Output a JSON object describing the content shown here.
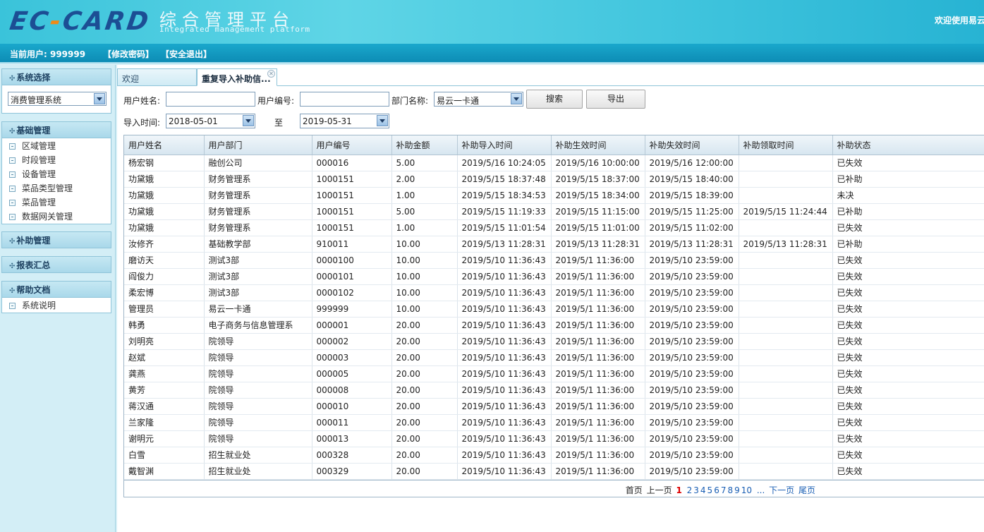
{
  "header": {
    "logo_left": "EC",
    "logo_dash": "-",
    "logo_right": "CARD",
    "brand_cn": "综合管理平台",
    "brand_en": "Integrated management platform",
    "welcome": "欢迎使用易云"
  },
  "userbar": {
    "current_user": "当前用户: 999999",
    "change_password": "【修改密码】",
    "logout": "【安全退出】"
  },
  "sidebar": {
    "system_select_title": "系统选择",
    "system_select_value": "消费管理系统",
    "basic_title": "基础管理",
    "basic_items": [
      "区域管理",
      "时段管理",
      "设备管理",
      "菜品类型管理",
      "菜品管理",
      "数据网关管理"
    ],
    "subsidy_title": "补助管理",
    "report_title": "报表汇总",
    "help_title": "帮助文档",
    "help_items": [
      "系统说明"
    ]
  },
  "tabs": {
    "welcome": "欢迎",
    "active": "重复导入补助信..."
  },
  "filters": {
    "user_name_label": "用户姓名:",
    "user_name_value": "",
    "user_no_label": "用户编号:",
    "user_no_value": "",
    "dept_label": "部门名称:",
    "dept_value": "易云一卡通",
    "search_button": "搜索",
    "export_button": "导出",
    "import_time_label": "导入时间:",
    "start_date": "2018-05-01",
    "to_label": "至",
    "end_date": "2019-05-31"
  },
  "table": {
    "columns": [
      "用户姓名",
      "用户部门",
      "用户编号",
      "补助金额",
      "补助导入时间",
      "补助生效时间",
      "补助失效时间",
      "补助领取时间",
      "补助状态"
    ],
    "rows": [
      [
        "杨宏钢",
        "融创公司",
        "000016",
        "5.00",
        "2019/5/16 10:24:05",
        "2019/5/16 10:00:00",
        "2019/5/16 12:00:00",
        "",
        "已失效"
      ],
      [
        "功黛娥",
        "财务管理系",
        "1000151",
        "2.00",
        "2019/5/15 18:37:48",
        "2019/5/15 18:37:00",
        "2019/5/15 18:40:00",
        "",
        "已补助"
      ],
      [
        "功黛娥",
        "财务管理系",
        "1000151",
        "1.00",
        "2019/5/15 18:34:53",
        "2019/5/15 18:34:00",
        "2019/5/15 18:39:00",
        "",
        "未决"
      ],
      [
        "功黛娥",
        "财务管理系",
        "1000151",
        "5.00",
        "2019/5/15 11:19:33",
        "2019/5/15 11:15:00",
        "2019/5/15 11:25:00",
        "2019/5/15 11:24:44",
        "已补助"
      ],
      [
        "功黛娥",
        "财务管理系",
        "1000151",
        "1.00",
        "2019/5/15 11:01:54",
        "2019/5/15 11:01:00",
        "2019/5/15 11:02:00",
        "",
        "已失效"
      ],
      [
        "汝修齐",
        "基础教学部",
        "910011",
        "10.00",
        "2019/5/13 11:28:31",
        "2019/5/13 11:28:31",
        "2019/5/13 11:28:31",
        "2019/5/13 11:28:31",
        "已补助"
      ],
      [
        "磨访天",
        "测试3部",
        "0000100",
        "10.00",
        "2019/5/10 11:36:43",
        "2019/5/1 11:36:00",
        "2019/5/10 23:59:00",
        "",
        "已失效"
      ],
      [
        "阎俊力",
        "测试3部",
        "0000101",
        "10.00",
        "2019/5/10 11:36:43",
        "2019/5/1 11:36:00",
        "2019/5/10 23:59:00",
        "",
        "已失效"
      ],
      [
        "柔宏博",
        "测试3部",
        "0000102",
        "10.00",
        "2019/5/10 11:36:43",
        "2019/5/1 11:36:00",
        "2019/5/10 23:59:00",
        "",
        "已失效"
      ],
      [
        "管理员",
        "易云一卡通",
        "999999",
        "10.00",
        "2019/5/10 11:36:43",
        "2019/5/1 11:36:00",
        "2019/5/10 23:59:00",
        "",
        "已失效"
      ],
      [
        "韩勇",
        "电子商务与信息管理系",
        "000001",
        "20.00",
        "2019/5/10 11:36:43",
        "2019/5/1 11:36:00",
        "2019/5/10 23:59:00",
        "",
        "已失效"
      ],
      [
        "刘明亮",
        "院领导",
        "000002",
        "20.00",
        "2019/5/10 11:36:43",
        "2019/5/1 11:36:00",
        "2019/5/10 23:59:00",
        "",
        "已失效"
      ],
      [
        "赵斌",
        "院领导",
        "000003",
        "20.00",
        "2019/5/10 11:36:43",
        "2019/5/1 11:36:00",
        "2019/5/10 23:59:00",
        "",
        "已失效"
      ],
      [
        "龚燕",
        "院领导",
        "000005",
        "20.00",
        "2019/5/10 11:36:43",
        "2019/5/1 11:36:00",
        "2019/5/10 23:59:00",
        "",
        "已失效"
      ],
      [
        "黄芳",
        "院领导",
        "000008",
        "20.00",
        "2019/5/10 11:36:43",
        "2019/5/1 11:36:00",
        "2019/5/10 23:59:00",
        "",
        "已失效"
      ],
      [
        "蒋汉通",
        "院领导",
        "000010",
        "20.00",
        "2019/5/10 11:36:43",
        "2019/5/1 11:36:00",
        "2019/5/10 23:59:00",
        "",
        "已失效"
      ],
      [
        "兰家隆",
        "院领导",
        "000011",
        "20.00",
        "2019/5/10 11:36:43",
        "2019/5/1 11:36:00",
        "2019/5/10 23:59:00",
        "",
        "已失效"
      ],
      [
        "谢明元",
        "院领导",
        "000013",
        "20.00",
        "2019/5/10 11:36:43",
        "2019/5/1 11:36:00",
        "2019/5/10 23:59:00",
        "",
        "已失效"
      ],
      [
        "白雪",
        "招生就业处",
        "000328",
        "20.00",
        "2019/5/10 11:36:43",
        "2019/5/1 11:36:00",
        "2019/5/10 23:59:00",
        "",
        "已失效"
      ],
      [
        "戴智渊",
        "招生就业处",
        "000329",
        "20.00",
        "2019/5/10 11:36:43",
        "2019/5/1 11:36:00",
        "2019/5/10 23:59:00",
        "",
        "已失效"
      ]
    ]
  },
  "pager": {
    "first": "首页",
    "prev": "上一页",
    "current": "1",
    "pages": [
      "2",
      "3",
      "4",
      "5",
      "6",
      "7",
      "8",
      "9",
      "10"
    ],
    "ellipsis": "...",
    "next": "下一页",
    "last": "尾页"
  },
  "colors": {
    "header_bg": "#3ac3da",
    "userbar_bg": "#0d8cb5",
    "sidebar_bg": "#d3eef6",
    "logo_blue": "#1c4e94",
    "logo_orange": "#f08a16",
    "current_page_red": "#dd0000",
    "link_blue": "#1a5fb4"
  }
}
